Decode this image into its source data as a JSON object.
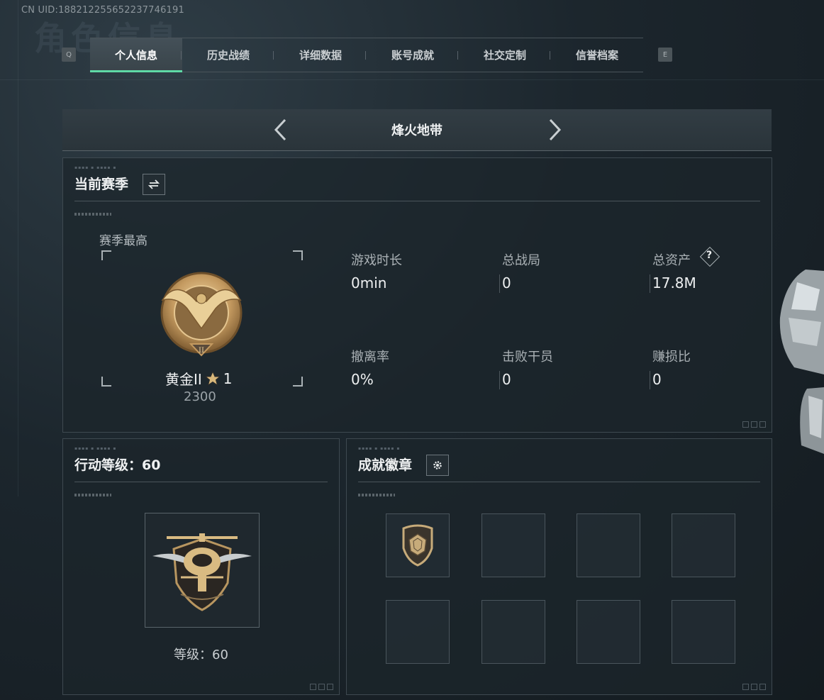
{
  "uid": "CN UID:18821225565223774619​1",
  "background_title": "角色信息",
  "tabs": {
    "left_key": "Q",
    "right_key": "E",
    "items": [
      "个人信息",
      "历史战绩",
      "详细数据",
      "账号成就",
      "社交定制",
      "信誉档案"
    ],
    "active_index": 0
  },
  "mode": {
    "label": "烽火地带"
  },
  "season": {
    "title": "当前赛季",
    "best_label": "赛季最高",
    "rank_name": "黄金II",
    "rank_stars": "1",
    "rank_score": "2300",
    "stats": [
      {
        "label": "游戏时长",
        "value": "0min"
      },
      {
        "label": "总战局",
        "value": "0"
      },
      {
        "label": "总资产",
        "value": "17.8M"
      },
      {
        "label": "撤离率",
        "value": "0%"
      },
      {
        "label": "击败干员",
        "value": "0"
      },
      {
        "label": "赚损比",
        "value": "0"
      }
    ],
    "help_icon": "?"
  },
  "level": {
    "title": "行动等级：60",
    "caption": "等级：60"
  },
  "badges": {
    "title": "成就徽章",
    "slots_filled": 1,
    "slots_total": 8
  },
  "colors": {
    "accent": "#5fd9a6",
    "gold": "#c9a46a"
  }
}
